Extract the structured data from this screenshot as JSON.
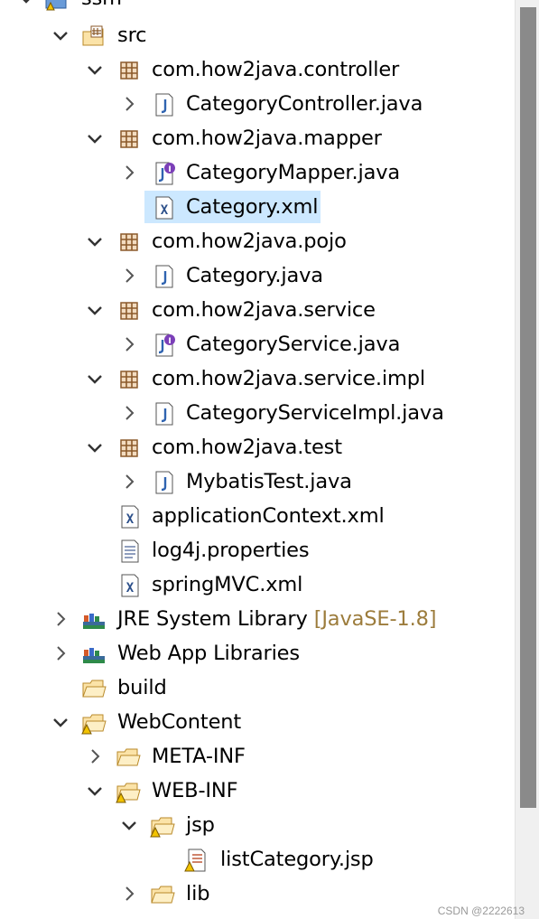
{
  "tree": {
    "project": {
      "label": "ssm",
      "icon": "web-project-icon",
      "expanded": true
    },
    "src": {
      "label": "src",
      "icon": "source-folder-icon",
      "expanded": true
    },
    "packages": [
      {
        "label": "com.how2java.controller",
        "icon": "package-icon",
        "expanded": true,
        "files": [
          {
            "label": "CategoryController.java",
            "icon": "java-class-icon"
          }
        ]
      },
      {
        "label": "com.how2java.mapper",
        "icon": "package-icon",
        "expanded": true,
        "files": [
          {
            "label": "CategoryMapper.java",
            "icon": "java-interface-icon"
          },
          {
            "label": "Category.xml",
            "icon": "xml-file-icon",
            "selected": true
          }
        ]
      },
      {
        "label": "com.how2java.pojo",
        "icon": "package-icon",
        "expanded": true,
        "files": [
          {
            "label": "Category.java",
            "icon": "java-class-icon"
          }
        ]
      },
      {
        "label": "com.how2java.service",
        "icon": "package-icon",
        "expanded": true,
        "files": [
          {
            "label": "CategoryService.java",
            "icon": "java-interface-icon"
          }
        ]
      },
      {
        "label": "com.how2java.service.impl",
        "icon": "package-icon",
        "expanded": true,
        "files": [
          {
            "label": "CategoryServiceImpl.java",
            "icon": "java-class-icon"
          }
        ]
      },
      {
        "label": "com.how2java.test",
        "icon": "package-icon",
        "expanded": true,
        "files": [
          {
            "label": "MybatisTest.java",
            "icon": "java-class-icon"
          }
        ]
      }
    ],
    "src_files": [
      {
        "label": "applicationContext.xml",
        "icon": "xml-file-icon"
      },
      {
        "label": "log4j.properties",
        "icon": "text-file-icon"
      },
      {
        "label": "springMVC.xml",
        "icon": "xml-file-icon"
      }
    ],
    "libraries": [
      {
        "label": "JRE System Library",
        "decoration": "[JavaSE-1.8]",
        "icon": "library-icon"
      },
      {
        "label": "Web App Libraries",
        "icon": "library-icon"
      }
    ],
    "build": {
      "label": "build",
      "icon": "folder-icon"
    },
    "webcontent": {
      "label": "WebContent",
      "icon": "folder-warning-icon",
      "expanded": true,
      "meta_inf": {
        "label": "META-INF",
        "icon": "folder-icon"
      },
      "web_inf": {
        "label": "WEB-INF",
        "icon": "folder-warning-icon",
        "expanded": true,
        "jsp": {
          "label": "jsp",
          "icon": "folder-warning-icon",
          "expanded": true,
          "files": [
            {
              "label": "listCategory.jsp",
              "icon": "jsp-file-warning-icon"
            }
          ]
        },
        "lib": {
          "label": "lib",
          "icon": "folder-icon"
        }
      }
    }
  },
  "watermark": "CSDN @2222613",
  "colors": {
    "selection": "#cce8ff",
    "decoration": "#9c7c3c",
    "package": "#8b5a2b",
    "java": "#2f63b0"
  }
}
